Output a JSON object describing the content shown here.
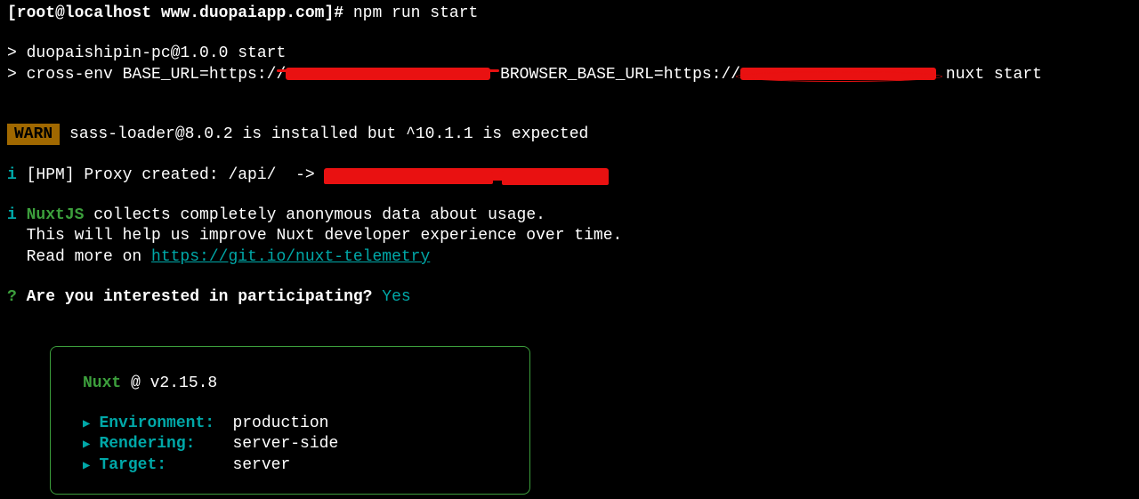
{
  "prompt": "[root@localhost www.duopaiapp.com]# ",
  "command": "npm run start",
  "output": {
    "scriptLine1": "> duopaishipin-pc@1.0.0 start",
    "scriptLine2a": "> cross-env BASE_URL=https://",
    "scriptLine2b": " BROWSER_BASE_URL=https://",
    "scriptLine2c": " nuxt start"
  },
  "warn": {
    "badge": "WARN",
    "text": " sass-loader@8.0.2 is installed but ^10.1.1 is expected"
  },
  "proxy": {
    "prefix": "i",
    "text": " [HPM] Proxy created: /api/  -> "
  },
  "telemetry": {
    "prefix": "i",
    "nuxt": "NuxtJS",
    "line1": " collects completely anonymous data about usage.",
    "line2": "  This will help us improve Nuxt developer experience over time.",
    "line3a": "  Read more on ",
    "link": "https://git.io/nuxt-telemetry"
  },
  "question": {
    "mark": "?",
    "text": " Are you interested in participating? ",
    "answer": "Yes"
  },
  "box": {
    "title": "Nuxt",
    "version": " @ v2.15.8",
    "envLabel": "Environment:",
    "envValue": "production",
    "renderLabel": "Rendering:",
    "renderValue": "server-side",
    "targetLabel": "Target:",
    "targetValue": "server"
  }
}
